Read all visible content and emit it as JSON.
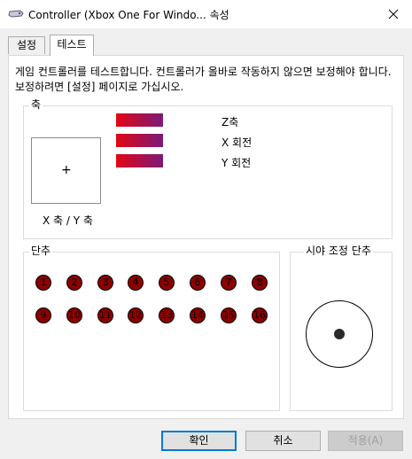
{
  "window": {
    "title": "Controller (Xbox One For Windo... 속성",
    "icon": "gamepad-icon",
    "close_icon": "close-icon"
  },
  "tabs": [
    {
      "label": "설정",
      "active": false
    },
    {
      "label": "테스트",
      "active": true
    }
  ],
  "description": "게임 컨트롤러를 테스트합니다. 컨트롤러가 올바로 작동하지 않으면 보정해야 합니다. 보정하려면 [설정] 페이지로 가십시오.",
  "axes": {
    "group_label": "축",
    "xy_cross": "+",
    "xy_label": "X 축 / Y 축",
    "bars": [
      {
        "label": "Z축",
        "level": 1.0
      },
      {
        "label": "X 회전",
        "level": 1.0
      },
      {
        "label": "Y 회전",
        "level": 1.0
      }
    ],
    "bar_gradient": [
      "#e30613",
      "#7a1a7a"
    ]
  },
  "buttons": {
    "group_label": "단추",
    "items": [
      "1",
      "2",
      "3",
      "4",
      "5",
      "6",
      "7",
      "8",
      "9",
      "10",
      "11",
      "12",
      "13",
      "14",
      "15",
      "16"
    ],
    "color": "#8b0000"
  },
  "pov": {
    "group_label": "시야 조정 단추"
  },
  "dialog_buttons": {
    "ok": "확인",
    "cancel": "취소",
    "apply": "적용(A)"
  }
}
